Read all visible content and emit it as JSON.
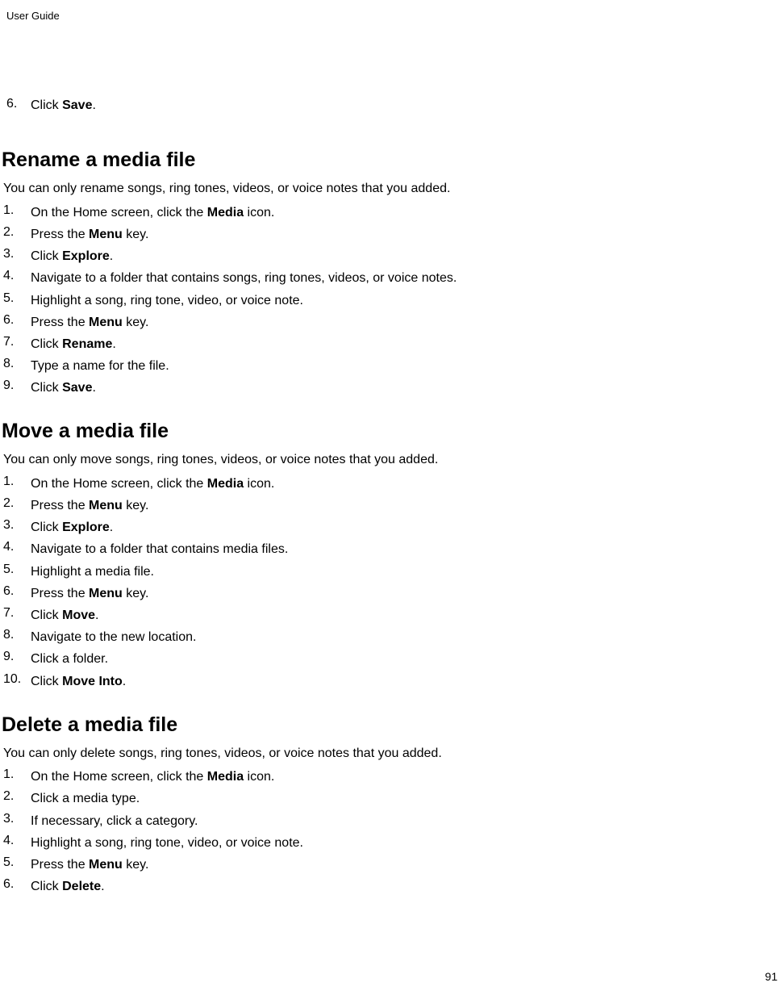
{
  "header": {
    "label": "User Guide"
  },
  "initialStep": {
    "number": "6.",
    "prefix": "Click ",
    "bold": "Save",
    "suffix": "."
  },
  "sections": [
    {
      "heading": "Rename a media file",
      "intro": "You can only rename songs, ring tones, videos, or voice notes that you added.",
      "steps": [
        {
          "number": "1.",
          "parts": [
            {
              "t": "On the Home screen, click the "
            },
            {
              "t": "Media",
              "b": true
            },
            {
              "t": " icon."
            }
          ]
        },
        {
          "number": "2.",
          "parts": [
            {
              "t": "Press the "
            },
            {
              "t": "Menu",
              "b": true
            },
            {
              "t": " key."
            }
          ]
        },
        {
          "number": "3.",
          "parts": [
            {
              "t": "Click "
            },
            {
              "t": "Explore",
              "b": true
            },
            {
              "t": "."
            }
          ]
        },
        {
          "number": "4.",
          "parts": [
            {
              "t": "Navigate to a folder that contains songs, ring tones, videos, or voice notes."
            }
          ]
        },
        {
          "number": "5.",
          "parts": [
            {
              "t": "Highlight a song, ring tone, video, or voice note."
            }
          ]
        },
        {
          "number": "6.",
          "parts": [
            {
              "t": "Press the "
            },
            {
              "t": "Menu",
              "b": true
            },
            {
              "t": " key."
            }
          ]
        },
        {
          "number": "7.",
          "parts": [
            {
              "t": "Click "
            },
            {
              "t": "Rename",
              "b": true
            },
            {
              "t": "."
            }
          ]
        },
        {
          "number": "8.",
          "parts": [
            {
              "t": "Type a name for the file."
            }
          ]
        },
        {
          "number": "9.",
          "parts": [
            {
              "t": "Click "
            },
            {
              "t": "Save",
              "b": true
            },
            {
              "t": "."
            }
          ]
        }
      ]
    },
    {
      "heading": "Move a media file",
      "intro": "You can only move songs, ring tones, videos, or voice notes that you added.",
      "steps": [
        {
          "number": "1.",
          "parts": [
            {
              "t": "On the Home screen, click the "
            },
            {
              "t": "Media",
              "b": true
            },
            {
              "t": " icon."
            }
          ]
        },
        {
          "number": "2.",
          "parts": [
            {
              "t": "Press the "
            },
            {
              "t": "Menu",
              "b": true
            },
            {
              "t": " key."
            }
          ]
        },
        {
          "number": "3.",
          "parts": [
            {
              "t": "Click "
            },
            {
              "t": "Explore",
              "b": true
            },
            {
              "t": "."
            }
          ]
        },
        {
          "number": "4.",
          "parts": [
            {
              "t": "Navigate to a folder that contains media files."
            }
          ]
        },
        {
          "number": "5.",
          "parts": [
            {
              "t": "Highlight a media file."
            }
          ]
        },
        {
          "number": "6.",
          "parts": [
            {
              "t": "Press the "
            },
            {
              "t": "Menu",
              "b": true
            },
            {
              "t": " key."
            }
          ]
        },
        {
          "number": "7.",
          "parts": [
            {
              "t": "Click "
            },
            {
              "t": "Move",
              "b": true
            },
            {
              "t": "."
            }
          ]
        },
        {
          "number": "8.",
          "parts": [
            {
              "t": "Navigate to the new location."
            }
          ]
        },
        {
          "number": "9.",
          "parts": [
            {
              "t": "Click a folder."
            }
          ]
        },
        {
          "number": "10.",
          "parts": [
            {
              "t": "Click "
            },
            {
              "t": "Move Into",
              "b": true
            },
            {
              "t": "."
            }
          ]
        }
      ]
    },
    {
      "heading": "Delete a media file",
      "intro": "You can only delete songs, ring tones, videos, or voice notes that you added.",
      "steps": [
        {
          "number": "1.",
          "parts": [
            {
              "t": "On the Home screen, click the "
            },
            {
              "t": "Media",
              "b": true
            },
            {
              "t": " icon."
            }
          ]
        },
        {
          "number": "2.",
          "parts": [
            {
              "t": "Click a media type."
            }
          ]
        },
        {
          "number": "3.",
          "parts": [
            {
              "t": "If necessary, click a category."
            }
          ]
        },
        {
          "number": "4.",
          "parts": [
            {
              "t": "Highlight a song, ring tone, video, or voice note."
            }
          ]
        },
        {
          "number": "5.",
          "parts": [
            {
              "t": "Press the "
            },
            {
              "t": "Menu",
              "b": true
            },
            {
              "t": " key."
            }
          ]
        },
        {
          "number": "6.",
          "parts": [
            {
              "t": "Click "
            },
            {
              "t": "Delete",
              "b": true
            },
            {
              "t": "."
            }
          ]
        }
      ]
    }
  ],
  "pageNumber": "91"
}
